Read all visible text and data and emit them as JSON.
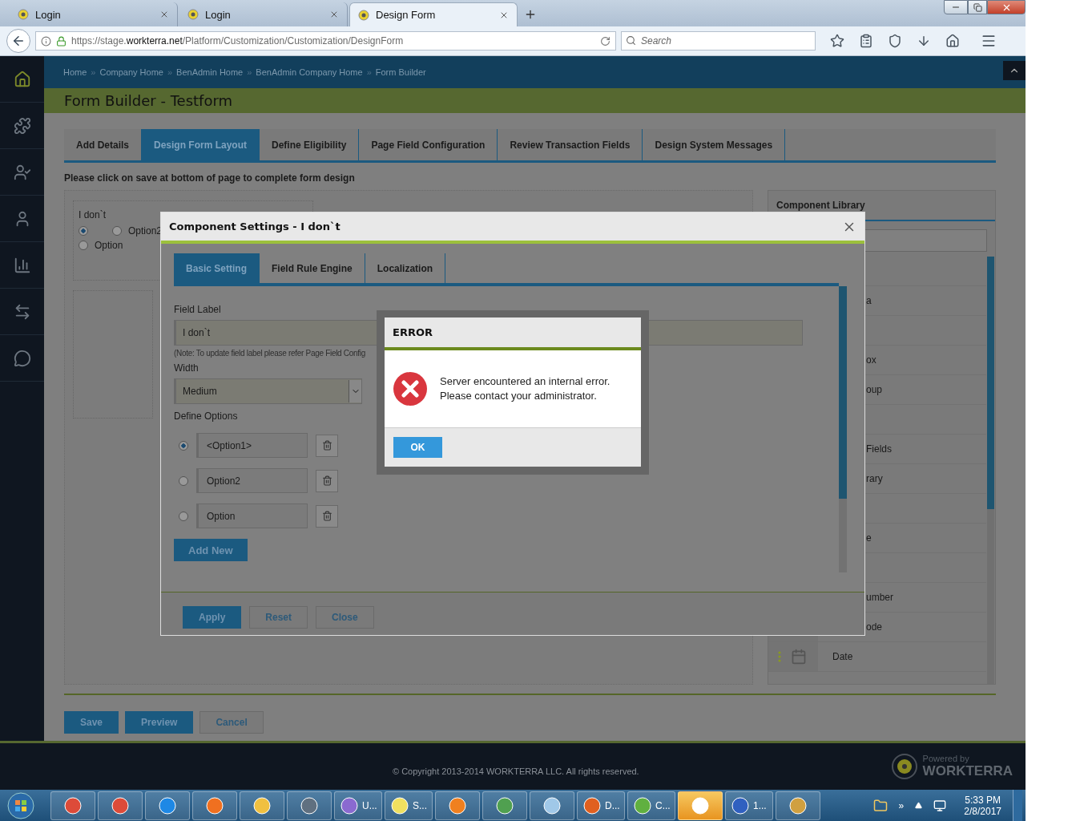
{
  "browser": {
    "tabs": [
      {
        "label": "Login",
        "selected": false
      },
      {
        "label": "Login",
        "selected": false
      },
      {
        "label": "Design Form",
        "selected": true
      }
    ],
    "url": {
      "scheme": "https://stage.",
      "domain": "workterra.net",
      "path": "/Platform/Customization/Customization/DesignForm"
    },
    "search": {
      "placeholder": "Search"
    }
  },
  "breadcrumbs": {
    "separator": "»",
    "items": [
      "Home",
      "Company Home",
      "BenAdmin Home",
      "BenAdmin Company Home",
      "Form Builder"
    ]
  },
  "page_title": "Form Builder - Testform",
  "form_tabs": [
    {
      "label": "Add Details",
      "selected": false
    },
    {
      "label": "Design Form Layout",
      "selected": true
    },
    {
      "label": "Define Eligibility",
      "selected": false
    },
    {
      "label": "Page Field Configuration",
      "selected": false
    },
    {
      "label": "Review Transaction Fields",
      "selected": false
    },
    {
      "label": "Design System Messages",
      "selected": false
    }
  ],
  "instruction": "Please click on save at bottom of page to complete form design",
  "canvas": {
    "field_label": "I don`t",
    "options": [
      {
        "selected": true
      },
      {
        "label": "Option2",
        "selected": false
      },
      {
        "label": "Option",
        "selected": false
      }
    ]
  },
  "library": {
    "title": "Component Library",
    "items": [
      {
        "kind": "covered"
      },
      {
        "kind": "covered",
        "label": "a"
      },
      {
        "kind": "covered"
      },
      {
        "kind": "covered",
        "label": "ox"
      },
      {
        "kind": "covered",
        "label": "oup"
      },
      {
        "kind": "covered"
      },
      {
        "kind": "covered",
        "label": "Fields"
      },
      {
        "kind": "covered",
        "label": "rary"
      },
      {
        "kind": "covered"
      },
      {
        "kind": "covered",
        "label": "e"
      },
      {
        "kind": "covered"
      },
      {
        "kind": "covered",
        "label": "umber"
      },
      {
        "kind": "covered",
        "label": "ode"
      },
      {
        "kind": "date",
        "label": "Date"
      }
    ]
  },
  "actions": [
    {
      "label": "Save",
      "kind": "primary"
    },
    {
      "label": "Preview",
      "kind": "primary"
    },
    {
      "label": "Cancel",
      "kind": "secondary"
    }
  ],
  "footer": {
    "copyright": "© Copyright 2013-2014 WORKTERRA LLC. All rights reserved.",
    "powered_by": "Powered by",
    "brand": "WORKTERRA"
  },
  "settings_dialog": {
    "title": "Component Settings - I don`t",
    "tabs": [
      {
        "label": "Basic Setting",
        "selected": true
      },
      {
        "label": "Field Rule Engine",
        "selected": false
      },
      {
        "label": "Localization",
        "selected": false
      }
    ],
    "field_label": {
      "label": "Field Label",
      "value": "I don`t",
      "note": "(Note: To update field label please refer Page Field Config"
    },
    "width": {
      "label": "Width",
      "value": "Medium"
    },
    "options_label": "Define Options",
    "options": [
      {
        "value": "<Option1>",
        "selected": true
      },
      {
        "value": "Option2",
        "selected": false
      },
      {
        "value": "Option",
        "selected": false
      }
    ],
    "add_button": "Add New",
    "buttons": [
      {
        "label": "Apply",
        "kind": "primary"
      },
      {
        "label": "Reset",
        "kind": "secondary"
      },
      {
        "label": "Close",
        "kind": "secondary"
      }
    ]
  },
  "error_dialog": {
    "title": "ERROR",
    "message": [
      "Server encountered an internal error.",
      "Please contact your administrator."
    ],
    "ok": "OK"
  },
  "taskbar": {
    "items": [
      {
        "highlighted": false
      },
      {
        "highlighted": false
      },
      {
        "highlighted": false
      },
      {
        "highlighted": false
      },
      {
        "highlighted": false
      },
      {
        "highlighted": false
      },
      {
        "label": "U...",
        "highlighted": false
      },
      {
        "label": "S...",
        "highlighted": false
      },
      {
        "highlighted": false
      },
      {
        "highlighted": false
      },
      {
        "highlighted": false
      },
      {
        "label": "D...",
        "highlighted": false
      },
      {
        "label": "C...",
        "highlighted": false
      },
      {
        "highlighted": true
      },
      {
        "label": "1...",
        "highlighted": false
      },
      {
        "highlighted": false
      }
    ],
    "tray_more": "»",
    "clock": {
      "time": "5:33 PM",
      "date": "2/8/2017"
    }
  }
}
